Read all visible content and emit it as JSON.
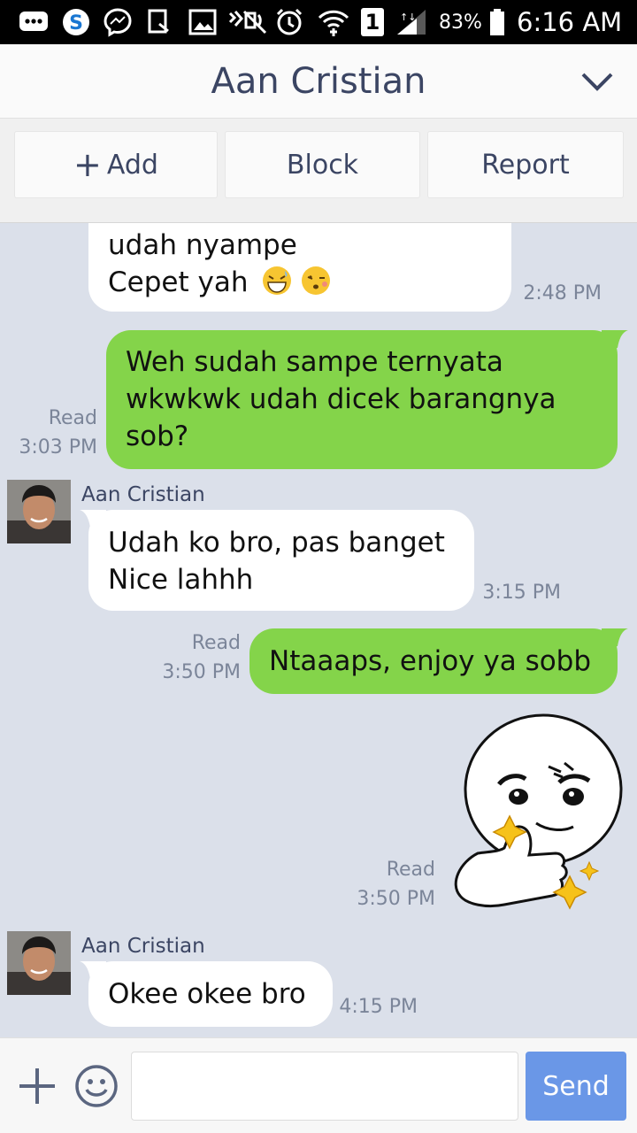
{
  "status_bar": {
    "battery_percent": "83%",
    "time": "6:16 AM",
    "sim_slot": "1"
  },
  "header": {
    "contact_name": "Aan Cristian"
  },
  "actions": {
    "add_label": "Add",
    "block_label": "Block",
    "report_label": "Report"
  },
  "messages": [
    {
      "side": "in",
      "lines": [
        "udah nyampe",
        "Cepet yah"
      ],
      "time": "2:48 PM",
      "emoji": [
        "grinning-sweat",
        "winking-kiss"
      ]
    },
    {
      "side": "out",
      "lines": [
        "Weh sudah sampe ternyata",
        "wkwkwk udah dicek barangnya",
        "sob?"
      ],
      "read": "Read",
      "time": "3:03 PM"
    },
    {
      "side": "in",
      "sender": "Aan Cristian",
      "lines": [
        "Udah ko bro, pas banget",
        "Nice lahhh"
      ],
      "time": "3:15 PM"
    },
    {
      "side": "out",
      "lines": [
        "Ntaaaps, enjoy ya sobb"
      ],
      "read": "Read",
      "time": "3:50 PM"
    },
    {
      "side": "out",
      "sticker": "thumbs-up-smirk-sticker",
      "read": "Read",
      "time": "3:50 PM"
    },
    {
      "side": "in",
      "sender": "Aan Cristian",
      "lines": [
        "Okee okee bro"
      ],
      "time": "4:15 PM"
    }
  ],
  "composer": {
    "input_value": "",
    "send_label": "Send"
  },
  "colors": {
    "outgoing_bubble": "#84d44a",
    "incoming_bubble": "#ffffff",
    "chat_background": "#dbe0ea",
    "send_button": "#5b8de6"
  }
}
